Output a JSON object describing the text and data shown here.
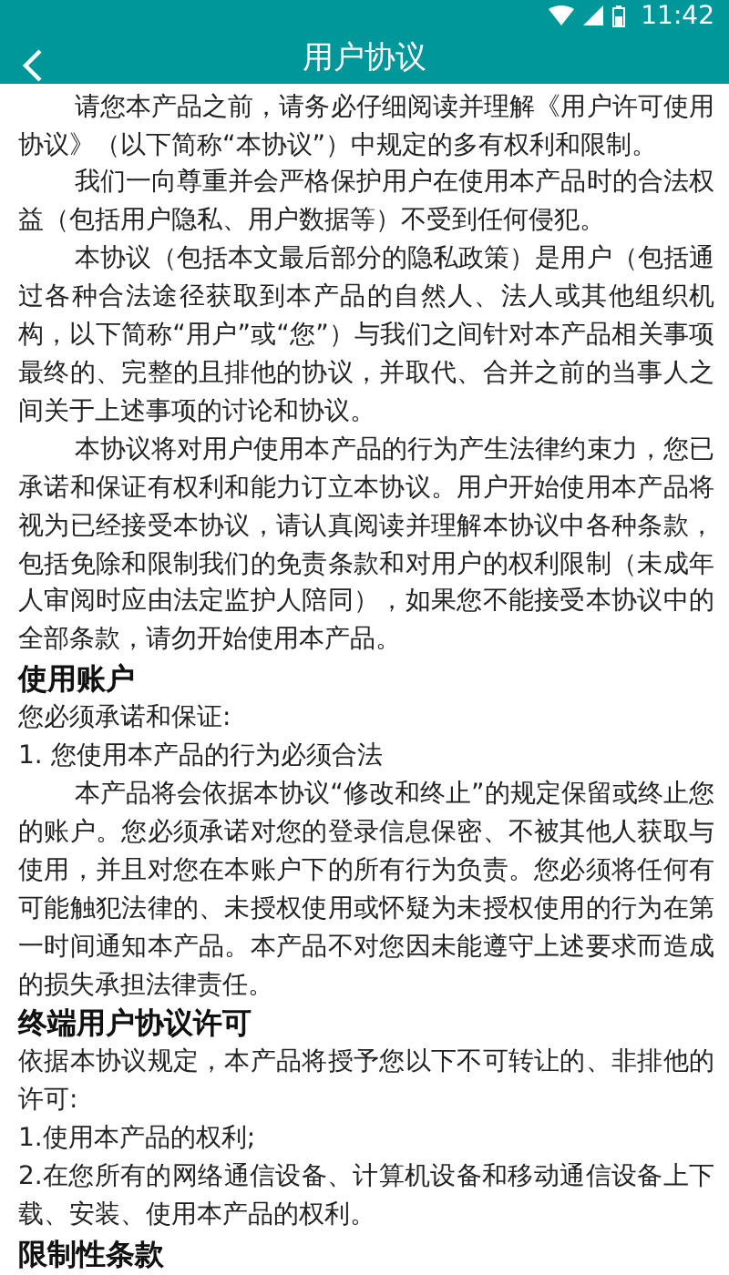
{
  "status_bar": {
    "time": "11:42"
  },
  "app_bar": {
    "title": "用户协议"
  },
  "content": [
    {
      "kind": "para",
      "text": "请您本产品之前，请务必仔细阅读并理解《用户许可使用协议》（以下简称“本协议”）中规定的多有权利和限制。"
    },
    {
      "kind": "para",
      "text": "我们一向尊重并会严格保护用户在使用本产品时的合法权益（包括用户隐私、用户数据等）不受到任何侵犯。"
    },
    {
      "kind": "para",
      "text": "本协议（包括本文最后部分的隐私政策）是用户（包括通过各种合法途径获取到本产品的自然人、法人或其他组织机构，以下简称“用户”或“您”）与我们之间针对本产品相关事项最终的、完整的且排他的协议，并取代、合并之前的当事人之间关于上述事项的讨论和协议。"
    },
    {
      "kind": "para",
      "text": "本协议将对用户使用本产品的行为产生法律约束力，您已承诺和保证有权利和能力订立本协议。用户开始使用本产品将视为已经接受本协议，请认真阅读并理解本协议中各种条款，包括免除和限制我们的免责条款和对用户的权利限制（未成年人审阅时应由法定监护人陪同），如果您不能接受本协议中的全部条款，请勿开始使用本产品。"
    },
    {
      "kind": "heading",
      "text": "使用账户"
    },
    {
      "kind": "line",
      "text": "您必须承诺和保证:"
    },
    {
      "kind": "line",
      "text": "1. 您使用本产品的行为必须合法"
    },
    {
      "kind": "para",
      "text": "本产品将会依据本协议“修改和终止”的规定保留或终止您的账户。您必须承诺对您的登录信息保密、不被其他人获取与使用，并且对您在本账户下的所有行为负责。您必须将任何有可能触犯法律的、未授权使用或怀疑为未授权使用的行为在第一时间通知本产品。本产品不对您因未能遵守上述要求而造成的损失承担法律责任。"
    },
    {
      "kind": "heading",
      "text": "终端用户协议许可"
    },
    {
      "kind": "line",
      "text": "依据本协议规定，本产品将授予您以下不可转让的、非排他的许可:"
    },
    {
      "kind": "line",
      "text": "1.使用本产品的权利;"
    },
    {
      "kind": "line",
      "text": "2.在您所有的网络通信设备、计算机设备和移动通信设备上下载、安装、使用本产品的权利。"
    },
    {
      "kind": "heading",
      "text": "限制性条款"
    }
  ]
}
